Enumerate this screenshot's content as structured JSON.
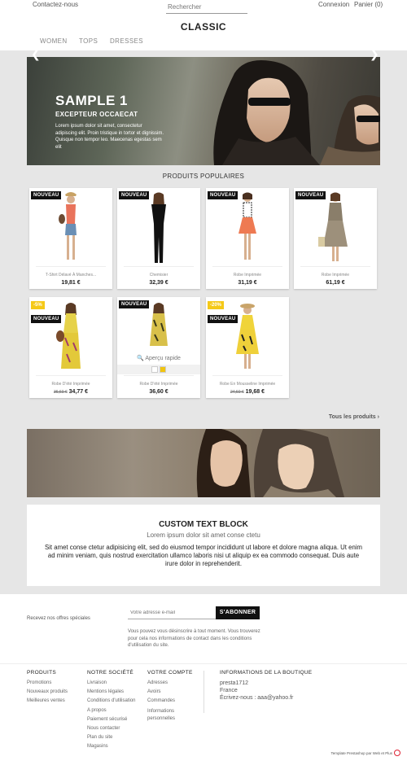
{
  "header": {
    "contact": "Contactez-nous",
    "search_placeholder": "Rechercher",
    "login": "Connexion",
    "cart": "Panier (0)",
    "logo": "CLASSIC",
    "nav": [
      "WOMEN",
      "TOPS",
      "DRESSES"
    ]
  },
  "slider": {
    "title": "SAMPLE 1",
    "subtitle": "EXCEPTEUR OCCAECAT",
    "text": "Lorem ipsum dolor sit amet, consectetur adipiscing elit. Proin tristique in tortor et dignissim. Quisque non tempor leo. Maecenas egestas sem elit",
    "prev_icon": "chevron-left-icon",
    "next_icon": "chevron-right-icon"
  },
  "products": {
    "title": "PRODUITS POPULAIRES",
    "items": [
      {
        "name": "T-Shirt Délavé À Manches...",
        "price": "19,81 €",
        "old_price": "",
        "badge": "NOUVEAU",
        "discount": ""
      },
      {
        "name": "Chemisier",
        "price": "32,39 €",
        "old_price": "",
        "badge": "NOUVEAU",
        "discount": ""
      },
      {
        "name": "Robe Imprimée",
        "price": "31,19 €",
        "old_price": "",
        "badge": "NOUVEAU",
        "discount": ""
      },
      {
        "name": "Robe Imprimée",
        "price": "61,19 €",
        "old_price": "",
        "badge": "NOUVEAU",
        "discount": ""
      },
      {
        "name": "Robe D'été Imprimée",
        "price": "34,77 €",
        "old_price": "36,60 €",
        "badge": "NOUVEAU",
        "discount": "-5%"
      },
      {
        "name": "Robe D'été Imprimée",
        "price": "36,60 €",
        "old_price": "",
        "badge": "NOUVEAU",
        "discount": ""
      },
      {
        "name": "Robe En Mousseline Imprimée",
        "price": "19,68 €",
        "old_price": "24,60 €",
        "badge": "NOUVEAU",
        "discount": "-20%"
      }
    ],
    "quick_view": "Aperçu rapide",
    "swatch_colors": [
      "#ffffff",
      "#f1c40f"
    ],
    "all_products": "Tous les produits"
  },
  "custom_block": {
    "title": "CUSTOM TEXT BLOCK",
    "subtitle": "Lorem ipsum dolor sit amet conse ctetu",
    "text": "Sit amet conse ctetur adipisicing elit, sed do eiusmod tempor incididunt ut labore et dolore magna aliqua. Ut enim ad minim veniam, quis nostrud exercitation ullamco laboris nisi ut aliquip ex ea commodo consequat. Duis aute irure dolor in reprehenderit."
  },
  "newsletter": {
    "label": "Recevez nos offres spéciales",
    "placeholder": "Votre adresse e-mail",
    "button": "S'ABONNER",
    "note": "Vous pouvez vous désinscrire à tout moment. Vous trouverez pour cela nos informations de contact dans les conditions d'utilisation du site."
  },
  "footer": {
    "columns": [
      {
        "title": "PRODUITS",
        "links": [
          "Promotions",
          "Nouveaux produits",
          "Meilleures ventes"
        ]
      },
      {
        "title": "NOTRE SOCIÉTÉ",
        "links": [
          "Livraison",
          "Mentions légales",
          "Conditions d'utilisation",
          "A propos",
          "Paiement sécurisé",
          "Nous contacter",
          "Plan du site",
          "Magasins"
        ]
      },
      {
        "title": "VOTRE COMPTE",
        "links": [
          "Adresses",
          "Avoirs",
          "Commandes",
          "Informations personnelles"
        ]
      }
    ],
    "shop_info": {
      "title": "INFORMATIONS DE LA BOUTIQUE",
      "name": "presta1712",
      "country": "France",
      "email": "Écrivez-nous : aaa@yahoo.fr"
    },
    "credit": "Template Prestashop par Web et Plus"
  },
  "colors": {
    "background_band": "#e6e6e6",
    "badge_new": "#111111",
    "badge_discount": "#f5c918",
    "button": "#111111"
  }
}
